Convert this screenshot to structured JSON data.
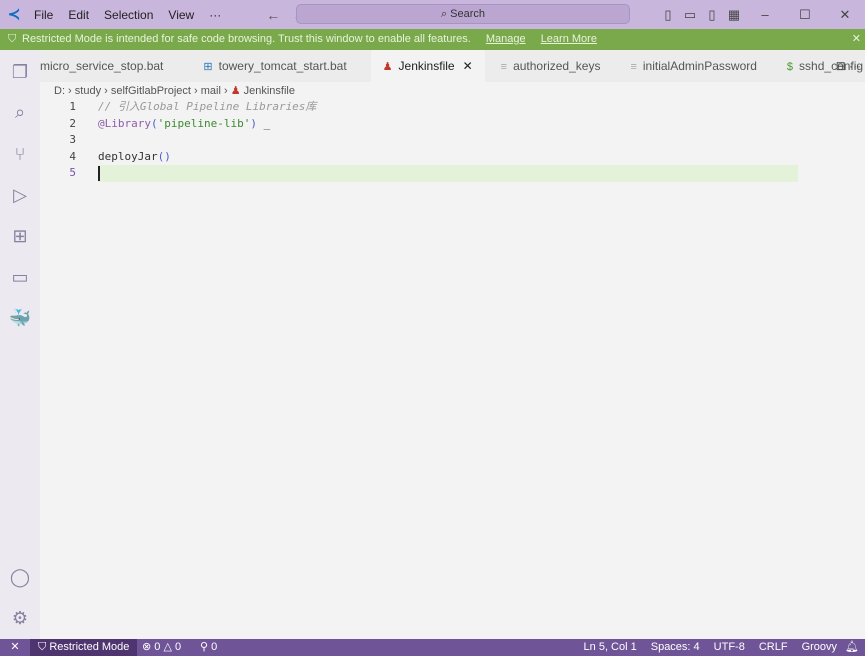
{
  "titlebar": {
    "menu": [
      "File",
      "Edit",
      "Selection",
      "View",
      "···"
    ],
    "search": "Search"
  },
  "banner": {
    "text": "Restricted Mode is intended for safe code browsing. Trust this window to enable all features.",
    "manage": "Manage",
    "learn_more": "Learn More"
  },
  "tabs": [
    {
      "label": "micro_service_stop.bat",
      "icon": ""
    },
    {
      "label": "towery_tomcat_start.bat",
      "icon": "windows-icon"
    },
    {
      "label": "Jenkinsfile",
      "icon": "jenkins-icon",
      "active": true
    },
    {
      "label": "authorized_keys",
      "icon": "lines-icon"
    },
    {
      "label": "initialAdminPassword",
      "icon": "lines-icon"
    },
    {
      "label": "sshd_config",
      "icon": "dollar-icon"
    }
  ],
  "breadcrumb": [
    "D:",
    "study",
    "selfGitlabProject",
    "mail",
    "Jenkinsfile"
  ],
  "code": {
    "l1": "// 引入Global Pipeline Libraries库",
    "l2a": "@Library",
    "l2b": "(",
    "l2c": "'pipeline-lib'",
    "l2d": ")",
    "l2e": " _",
    "l4a": "deployJar",
    "l4b": "()",
    "lines": [
      "1",
      "2",
      "3",
      "4",
      "5"
    ]
  },
  "status": {
    "mode": "Restricted Mode",
    "errors": "0",
    "warnings": "0",
    "ports": "0",
    "position": "Ln 5, Col 1",
    "spaces": "Spaces: 4",
    "encoding": "UTF-8",
    "eol": "CRLF",
    "language": "Groovy"
  },
  "colors": {
    "titlebar": "#c9b6dc",
    "banner": "#79a94a",
    "statusbar": "#6f5597"
  }
}
